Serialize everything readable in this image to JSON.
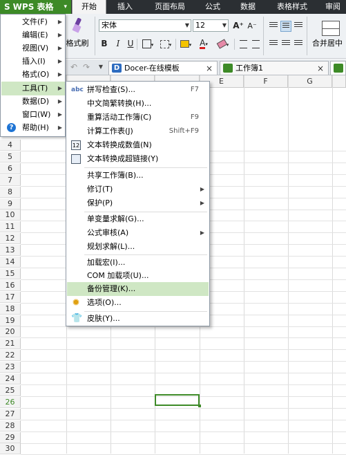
{
  "app": {
    "logo": "S",
    "button_label": "WPS 表格",
    "arrow": "▾"
  },
  "ribbon_tabs": [
    {
      "label": "开始",
      "active": true
    },
    {
      "label": "插入"
    },
    {
      "label": "页面布局"
    },
    {
      "label": "公式"
    },
    {
      "label": "数据"
    },
    {
      "label": "表格样式"
    },
    {
      "label": "审阅"
    }
  ],
  "toolbar": {
    "format_painter_label": "格式刷",
    "font_name": "宋体",
    "font_size": "12",
    "bold": "B",
    "italic": "I",
    "underline": "U",
    "grow_font": "A⁺",
    "shrink_font": "A⁻",
    "font_color_glyph": "A",
    "merge_center_label": "合并居中"
  },
  "doc_tabs": [
    {
      "title": "Docer-在线模板",
      "close": "×"
    },
    {
      "title": "工作簿1",
      "close": "×"
    }
  ],
  "grid": {
    "columns": [
      "E",
      "F",
      "G"
    ],
    "rows": [
      "4",
      "5",
      "6",
      "7",
      "8",
      "9",
      "10",
      "11",
      "12",
      "13",
      "14",
      "15",
      "16",
      "17",
      "18",
      "19",
      "20",
      "21",
      "22",
      "23",
      "24",
      "25",
      "26",
      "27",
      "28",
      "29",
      "30"
    ],
    "active_row": "26"
  },
  "main_menu": [
    {
      "label": "文件(F)"
    },
    {
      "label": "编辑(E)"
    },
    {
      "label": "视图(V)"
    },
    {
      "label": "插入(I)"
    },
    {
      "label": "格式(O)"
    },
    {
      "label": "工具(T)",
      "active": true
    },
    {
      "label": "数据(D)"
    },
    {
      "label": "窗口(W)"
    },
    {
      "label": "帮助(H)"
    }
  ],
  "tools_menu": [
    {
      "label": "拼写检查(S)...",
      "shortcut": "F7"
    },
    {
      "label": "中文简繁转换(H)..."
    },
    {
      "label": "重算活动工作簿(C)",
      "shortcut": "F9"
    },
    {
      "label": "计算工作表(J)",
      "shortcut": "Shift+F9"
    },
    {
      "label": "文本转换成数值(N)"
    },
    {
      "label": "文本转换成超链接(Y)"
    },
    {
      "label": "共享工作簿(B)..."
    },
    {
      "label": "修订(T)"
    },
    {
      "label": "保护(P)"
    },
    {
      "label": "单变量求解(G)..."
    },
    {
      "label": "公式审核(A)"
    },
    {
      "label": "规划求解(L)..."
    },
    {
      "label": "加载宏(I)..."
    },
    {
      "label": "COM 加载项(U)..."
    },
    {
      "label": "备份管理(K)..."
    },
    {
      "label": "选项(O)..."
    },
    {
      "label": "皮肤(Y)..."
    }
  ],
  "colors": {
    "brand_green": "#3d8a27",
    "highlight": "#cfe7c4",
    "ribbon_dark": "#2b2f33"
  }
}
